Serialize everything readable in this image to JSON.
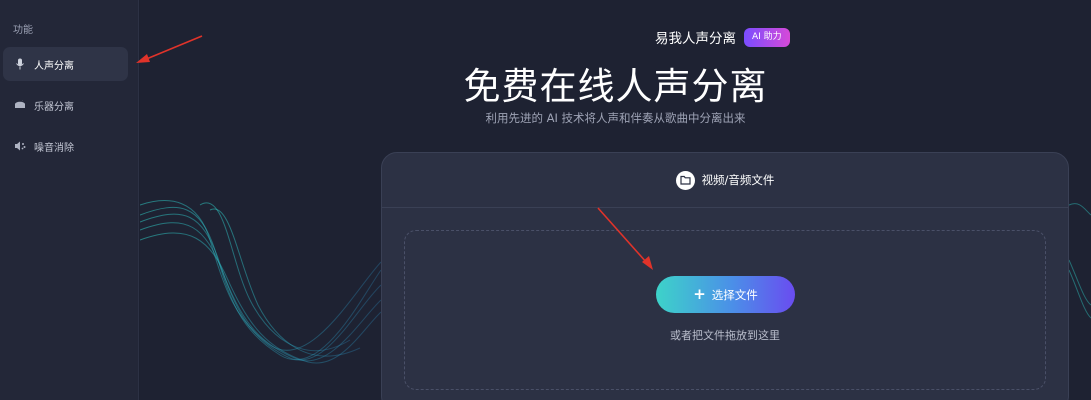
{
  "sidebar": {
    "section_title": "功能",
    "items": [
      {
        "label": "人声分离",
        "icon": "microphone-icon",
        "active": true
      },
      {
        "label": "乐器分离",
        "icon": "drum-icon",
        "active": false
      },
      {
        "label": "噪音消除",
        "icon": "noise-icon",
        "active": false
      }
    ]
  },
  "header": {
    "brand_name": "易我人声分离",
    "ai_badge": "AI 助力",
    "title": "免费在线人声分离",
    "subtitle": "利用先进的 AI 技术将人声和伴奏从歌曲中分离出来"
  },
  "upload": {
    "card_title": "视频/音频文件",
    "button_label": "选择文件",
    "drop_hint": "或者把文件拖放到这里"
  },
  "colors": {
    "background": "#1e2232",
    "sidebar": "#232738",
    "card": "#2c3144",
    "accent_start": "#3dd3c9",
    "accent_end": "#6a4cf0",
    "annotation_arrow": "#e0332a"
  }
}
